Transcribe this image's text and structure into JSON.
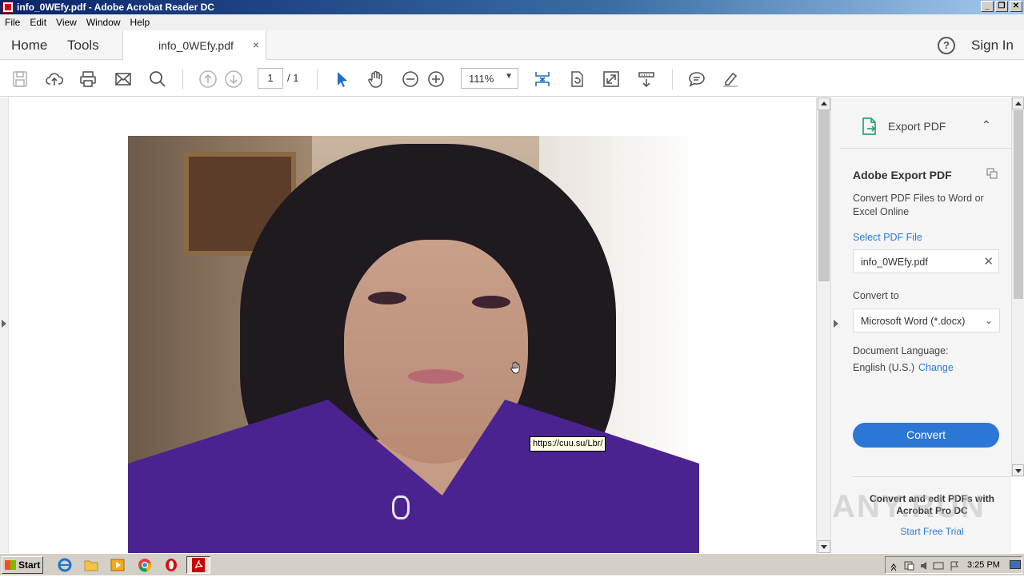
{
  "window": {
    "title": "info_0WEfy.pdf - Adobe Acrobat Reader DC",
    "controls": [
      "_",
      "❐",
      "✕"
    ]
  },
  "menu": [
    "File",
    "Edit",
    "View",
    "Window",
    "Help"
  ],
  "tabs": {
    "home": "Home",
    "tools": "Tools",
    "document": "info_0WEfy.pdf",
    "close": "×",
    "help": "?",
    "signin": "Sign In"
  },
  "toolbar": {
    "page_current": "1",
    "page_total": "/ 1",
    "zoom": "111%",
    "zoom_arrow": "▼"
  },
  "document": {
    "tooltip": "https://cuu.su/Lbr/"
  },
  "export_pane": {
    "header": "Export PDF",
    "chevron": "⌃",
    "title": "Adobe Export PDF",
    "description": "Convert PDF Files to Word or Excel Online",
    "select_file": "Select PDF File",
    "file_name": "info_0WEfy.pdf",
    "clear": "✕",
    "convert_to": "Convert to",
    "format": "Microsoft Word (*.docx)",
    "format_arrow": "⌄",
    "doc_language": "Document Language:",
    "language": "English (U.S.)",
    "change": "Change",
    "convert_button": "Convert",
    "promo": "Convert and edit PDFs with Acrobat Pro DC",
    "trial": "Start Free Trial",
    "watermark": "ANY.RUN"
  },
  "taskbar": {
    "start": "Start",
    "time": "3:25 PM"
  },
  "colors": {
    "accent": "#2c77d5",
    "link": "#2d7bd6",
    "toolbar_icon": "#1f6fc6"
  }
}
